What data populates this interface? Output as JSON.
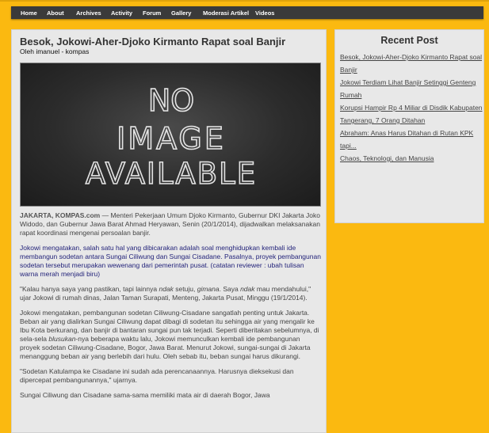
{
  "nav": {
    "items": [
      "Home",
      "About",
      "Archives",
      "Activity",
      "Forum",
      "Gallery",
      "Moderasi Artikel",
      "Videos"
    ]
  },
  "post": {
    "title": "Besok, Jokowi-Aher-Djoko Kirmanto Rapat soal Banjir",
    "byline": "Oleh imanuel - kompas",
    "image_text": [
      "NO",
      "IMAGE",
      "AVAILABLE"
    ],
    "lead_label": "JAKARTA, KOMPAS.com",
    "lead_text": " — Menteri Pekerjaan Umum Djoko Kirmanto, Gubernur DKI Jakarta Joko Widodo, dan Gubernur Jawa Barat Ahmad Heryawan, Senin (20/1/2014), dijadwalkan melaksanakan rapat koordinasi mengenai persoalan banjir.",
    "p2": "Jokowi mengatakan, salah satu hal yang dibicarakan adalah soal menghidupkan kembali ide membangun sodetan antara Sungai Ciliwung dan Sungai Cisadane. Pasalnya, proyek pembangunan sodetan tersebut merupakan wewenang dari pemerintah pusat. (catatan reviewer : ubah tulisan warna merah menjadi biru)",
    "p3_a": "\"Kalau hanya saya yang pastikan, tapi lainnya ",
    "p3_em1": "ndak",
    "p3_b": " setuju, ",
    "p3_em2": "gimana",
    "p3_c": ". Saya ",
    "p3_em3": "ndak",
    "p3_d": " mau mendahului,\" ujar Jokowi di rumah dinas, Jalan Taman Surapati, Menteng, Jakarta Pusat, Minggu (19/1/2014).",
    "p4_a": "Jokowi mengatakan, pembangunan sodetan Ciliwung-Cisadane sangatlah penting untuk Jakarta. Beban air yang dialirkan Sungai Ciliwung dapat dibagi di sodetan itu sehingga air yang mengalir ke Ibu Kota berkurang, dan banjir di bantaran sungai pun tak terjadi. Seperti diberitakan sebelumnya, di sela-sela ",
    "p4_em": "blusukan",
    "p4_b": "-nya beberapa waktu lalu, Jokowi memunculkan kembali ide pembangunan proyek sodetan Ciliwung-Cisadane, Bogor, Jawa Barat. Menurut Jokowi, sungai-sungai di Jakarta menanggung beban air yang berlebih dari hulu. Oleh sebab itu, beban sungai harus dikurangi.",
    "p5": "\"Sodetan Katulampa ke Cisadane ini sudah ada perencanaannya. Harusnya dieksekusi dan dipercepat pembangunannya,\" ujarnya.",
    "p6": "Sungai Ciliwung dan Cisadane sama-sama memiliki mata air di daerah Bogor, Jawa"
  },
  "sidebar": {
    "heading": "Recent Post",
    "links": [
      "Besok, Jokowi-Aher-Djoko Kirmanto Rapat soal Banjir",
      "Jokowi Terdiam Lihat Banjir Setinggi Genteng Rumah",
      "Korupsi Hampir Rp 4 Miliar di Disdik Kabupaten Tangerang, 7 Orang Ditahan",
      "Abraham: Anas Harus Ditahan di Rutan KPK tapi...",
      "Chaos, Teknologi, dan Manusia"
    ]
  }
}
